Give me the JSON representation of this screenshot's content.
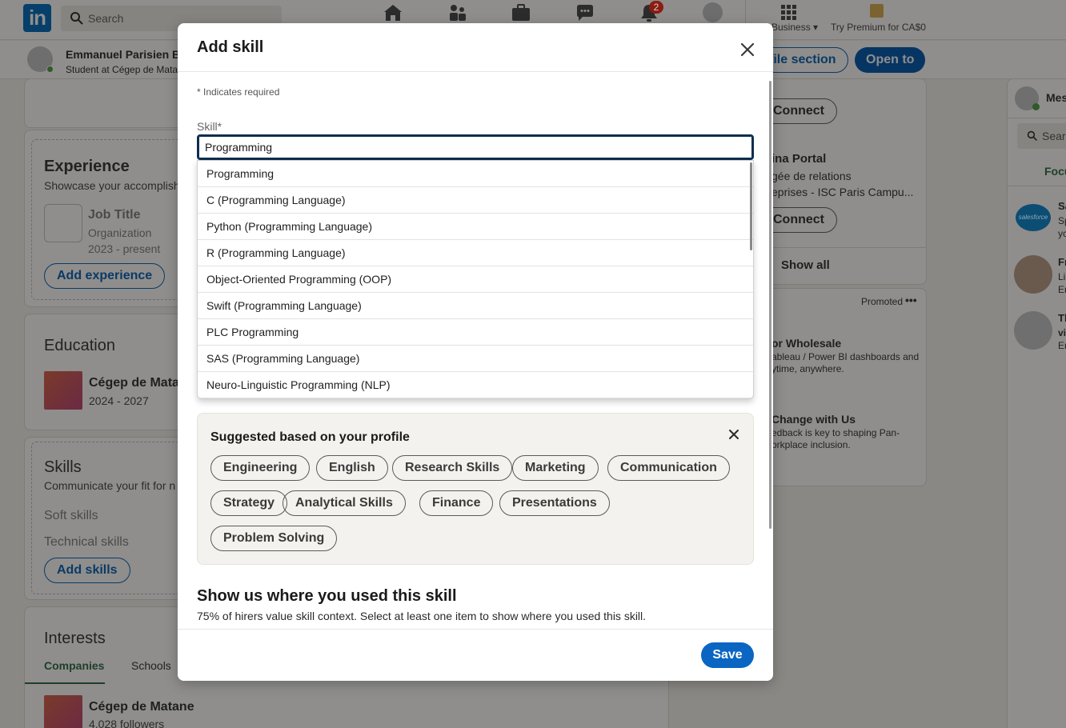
{
  "nav": {
    "search_placeholder": "Search",
    "notification_count": "2",
    "business_label": "Business",
    "premium_label": "Try Premium for CA$0"
  },
  "profile_bar": {
    "name": "Emmanuel Parisien Bo",
    "role": "Student at Cégep de Matan",
    "add_section_label": "file section",
    "open_to_label": "Open to"
  },
  "background": {
    "experience": {
      "title": "Experience",
      "subtitle": "Showcase your accomplishm",
      "job_title": "Job Title",
      "organization": "Organization",
      "dates": "2023 - present",
      "add_button": "Add experience"
    },
    "education": {
      "title": "Education",
      "school": "Cégep de Mata",
      "dates": "2024 - 2027"
    },
    "skills": {
      "title": "Skills",
      "subtitle": "Communicate your fit for n",
      "soft": "Soft skills",
      "technical": "Technical skills",
      "add_button": "Add skills"
    },
    "interests": {
      "title": "Interests",
      "tab_companies": "Companies",
      "tab_schools": "Schools",
      "company_name": "Cégep de Matane",
      "company_followers": "4,028 followers"
    },
    "right_column": {
      "connect_1": "Connect",
      "person_name": "ina Portal",
      "person_line1": "gée de relations",
      "person_line2": "eprises - ISC Paris Campu...",
      "connect_2": "Connect",
      "show_all": "Show all",
      "promoted": "Promoted",
      "ad1_title": "or Wholesale",
      "ad1_line1": "ableau / Power BI dashboards and",
      "ad1_line2": "ytime, anywhere.",
      "ad2_title": "Change with Us",
      "ad2_line1": "edback is key to shaping Pan-",
      "ad2_line2": "orkplace inclusion."
    },
    "messaging": {
      "label": "Mes",
      "search": "Searc",
      "tab": "Focu",
      "r1a": "Sa",
      "r1b": "Sp",
      "r1c": "yc",
      "r2a": "Fr",
      "r2b": "Li",
      "r2c": "Er",
      "r3a": "Th",
      "r3b": "vi",
      "r3c": "Er",
      "salesforce": "salesforce"
    }
  },
  "modal": {
    "title": "Add skill",
    "required_note": "* Indicates required",
    "skill_label": "Skill*",
    "skill_value": "Programming",
    "dropdown_options": [
      "Programming",
      "C (Programming Language)",
      "Python (Programming Language)",
      "R (Programming Language)",
      "Object-Oriented Programming (OOP)",
      "Swift (Programming Language)",
      "PLC Programming",
      "SAS (Programming Language)",
      "Neuro-Linguistic Programming (NLP)"
    ],
    "suggested": {
      "title": "Suggested based on your profile",
      "chips": [
        "Engineering",
        "English",
        "Research Skills",
        "Marketing",
        "Communication",
        "Strategy",
        "Analytical Skills",
        "Finance",
        "Presentations",
        "Problem Solving"
      ]
    },
    "context_title": "Show us where you used this skill",
    "context_subtitle": "75% of hirers value skill context. Select at least one item to show where you used this skill.",
    "save_label": "Save"
  },
  "colors": {
    "primary": "#0a66c2",
    "overlay": "#8f8e8c",
    "input_border": "#0d2e4e"
  }
}
